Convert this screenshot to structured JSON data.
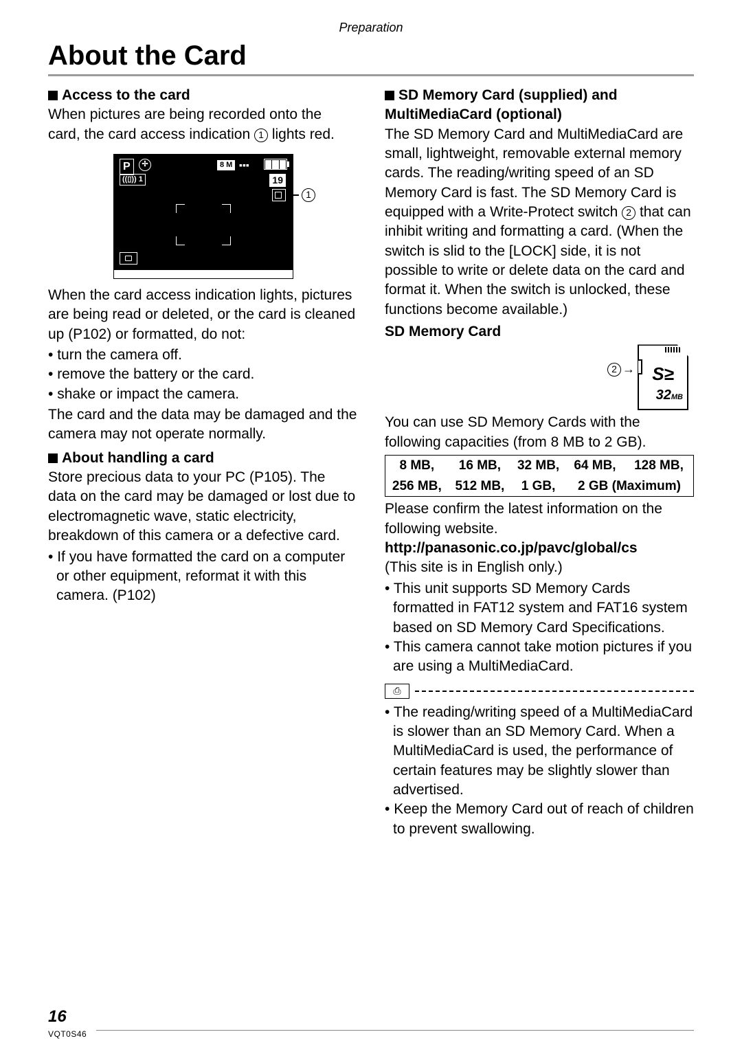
{
  "header": {
    "section": "Preparation"
  },
  "title": "About the Card",
  "left": {
    "sub1": "Access to the card",
    "p1a": "When pictures are being recorded onto the card, the card access indication ",
    "p1b": " lights red.",
    "screen": {
      "mode": "P",
      "res": "8 M",
      "count": "19",
      "stab": "((▯)) 1",
      "cap32": "32",
      "capmb": "MB"
    },
    "callout1": "1",
    "p2": "When the card access indication lights, pictures are being read or deleted, or the card is cleaned up (P102) or formatted, do not:",
    "b1": "turn the camera off.",
    "b2": "remove the battery or the card.",
    "b3": "shake or impact the camera.",
    "p3": "The card and the data may be damaged and the camera may not operate normally.",
    "sub2": "About handling a card",
    "p4": "Store precious data to your PC (P105). The data on the card may be damaged or lost due to electromagnetic wave, static electricity, breakdown of this camera or a defective card.",
    "b4": "If you have formatted the card on a computer or other equipment, reformat it with this camera. (P102)"
  },
  "right": {
    "sub1": "SD Memory Card (supplied) and MultiMediaCard (optional)",
    "p1a": "The SD Memory Card and MultiMediaCard are small, lightweight, removable external memory cards. The reading/writing speed of an SD Memory Card is fast. The SD Memory Card is equipped with a Write-Protect switch ",
    "p1b": " that can inhibit writing and formatting a card. (When the switch is slid to the [LOCK] side, it is not possible to write or delete data on the card and format it. When the switch is unlocked, these functions become available.)",
    "sub2": "SD Memory Card",
    "callout2": "2",
    "p2": "You can use SD Memory Cards with the following capacities (from 8 MB to 2 GB).",
    "capacities": {
      "r1": [
        "8 MB,",
        "16 MB,",
        "32 MB,",
        "64 MB,",
        "128 MB,"
      ],
      "r2": [
        "256 MB,",
        "512 MB,",
        "1 GB,",
        "2 GB (Maximum)"
      ]
    },
    "p3": "Please confirm the latest information on the following website.",
    "url": "http://panasonic.co.jp/pavc/global/cs",
    "p4": "(This site is in English only.)",
    "b1": "This unit supports SD Memory Cards formatted in FAT12 system and FAT16 system based on SD Memory Card Specifications.",
    "b2": "This camera cannot take motion pictures if you are using a MultiMediaCard.",
    "n1": "The reading/writing speed of a MultiMediaCard is slower than an SD Memory Card. When a MultiMediaCard is used, the performance of certain features may be slightly slower than advertised.",
    "n2": "Keep the Memory Card out of reach of children to prevent swallowing."
  },
  "footer": {
    "page": "16",
    "code": "VQT0S46"
  }
}
